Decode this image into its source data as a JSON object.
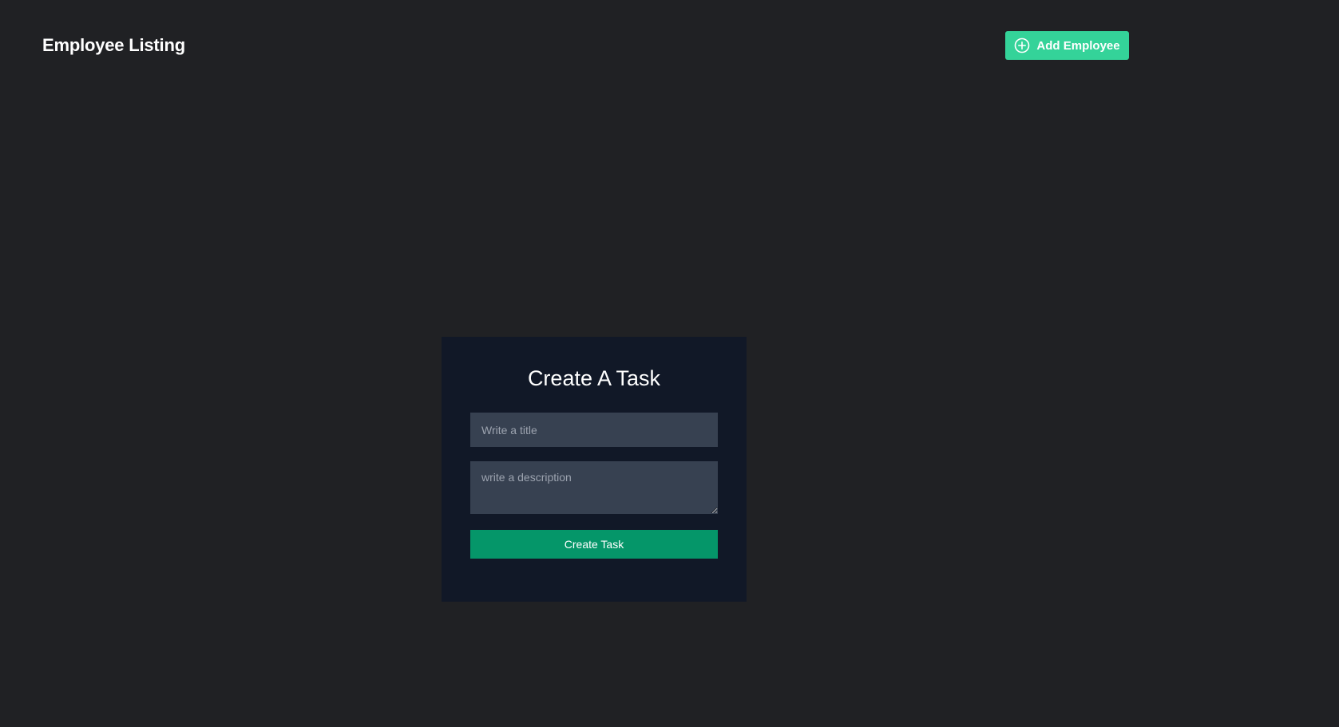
{
  "header": {
    "title": "Employee Listing",
    "add_button_label": "Add Employee",
    "add_button_icon": "plus-circle-icon"
  },
  "task_form": {
    "title": "Create A Task",
    "title_placeholder": "Write a title",
    "title_value": "",
    "description_placeholder": "write a description",
    "description_value": "",
    "submit_label": "Create Task"
  },
  "colors": {
    "background": "#202124",
    "card_background": "#111827",
    "input_background": "#374151",
    "add_button": "#34d399",
    "submit_button": "#059669"
  }
}
